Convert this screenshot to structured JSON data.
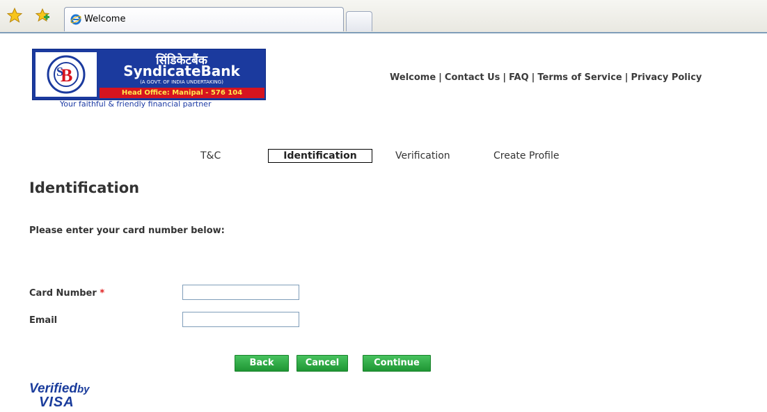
{
  "browser": {
    "tab_title": "Welcome",
    "icons": [
      "favorites-star-icon",
      "add-favorite-icon",
      "ie-icon",
      "new-tab-icon"
    ]
  },
  "logo": {
    "hindi_name": "सिंडिकेटबैंक",
    "name": "SyndicateBank",
    "sub": "(A GOVT. OF INDIA UNDERTAKING)",
    "head_office": "Head Office: Manipal - 576 104",
    "tagline": "Your faithful & friendly financial partner"
  },
  "top_nav": {
    "links": [
      "Welcome",
      "Contact Us",
      "FAQ",
      "Terms of Service",
      "Privacy Policy"
    ],
    "separator": "|"
  },
  "steps": [
    "T&C",
    "Identification",
    "Verification",
    "Create Profile"
  ],
  "page": {
    "title": "Identification",
    "instruction": "Please enter your card number below:"
  },
  "form": {
    "card_label": "Card Number",
    "required_mark": "*",
    "email_label": "Email",
    "card_value": "",
    "email_value": ""
  },
  "buttons": {
    "back": "Back",
    "cancel": "Cancel",
    "continue": "Continue"
  },
  "footer_logo": {
    "line1": "Verified",
    "line1_small": "by",
    "line2": "VISA"
  },
  "colors": {
    "brand_blue": "#1b3a9e",
    "brand_red": "#d6141f",
    "button_green": "#2aa844"
  }
}
